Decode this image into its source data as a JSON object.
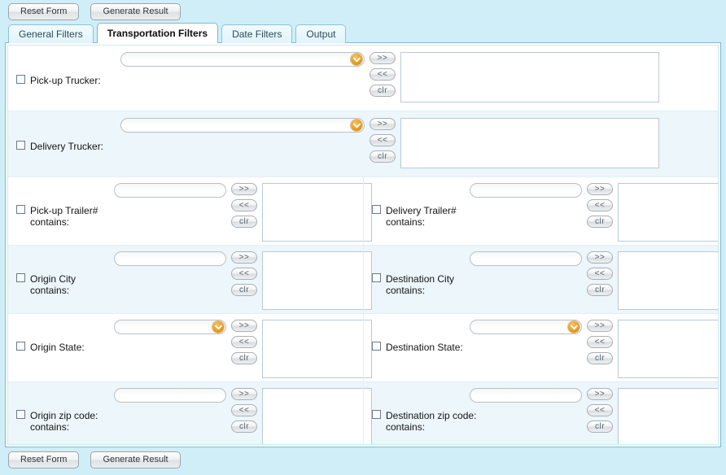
{
  "toolbar": {
    "reset_label": "Reset Form",
    "generate_label": "Generate Result"
  },
  "tabs": [
    {
      "label": "General Filters",
      "active": false
    },
    {
      "label": "Transportation Filters",
      "active": true
    },
    {
      "label": "Date Filters",
      "active": false
    },
    {
      "label": "Output",
      "active": false
    }
  ],
  "buttons": {
    "add_label": ">>",
    "remove_label": "<<",
    "clear_label": "clr"
  },
  "icons": {
    "combo_arrow": "chevron-down-icon"
  },
  "colors": {
    "window_background": "#cfeef8",
    "panel_background": "#ffffff",
    "row_shade": "#ecf6fb",
    "panel_border": "#7fb9d0",
    "tab_border": "#8cc3d8",
    "combo_arrow": "#e89b23",
    "listbox_border": "#b7cbd6",
    "input_border": "#b9c1c6"
  },
  "filters": [
    {
      "id": "pickup-trucker",
      "label": "Pick-up Trucker:",
      "control": "combo",
      "checked": false,
      "value": "",
      "layout": "full",
      "shaded": false,
      "selected_items": []
    },
    {
      "id": "delivery-trucker",
      "label": "Delivery Trucker:",
      "control": "combo",
      "checked": false,
      "value": "",
      "layout": "full",
      "shaded": true,
      "selected_items": []
    },
    {
      "id": "pickup-trailer",
      "label": "Pick-up Trailer#\ncontains:",
      "control": "text",
      "checked": false,
      "value": "",
      "layout": "half",
      "shaded": false,
      "selected_items": []
    },
    {
      "id": "delivery-trailer",
      "label": "Delivery Trailer#\ncontains:",
      "control": "text",
      "checked": false,
      "value": "",
      "layout": "half",
      "shaded": false,
      "selected_items": []
    },
    {
      "id": "origin-city",
      "label": "Origin City\ncontains:",
      "control": "text",
      "checked": false,
      "value": "",
      "layout": "half",
      "shaded": true,
      "selected_items": []
    },
    {
      "id": "destination-city",
      "label": "Destination City\ncontains:",
      "control": "text",
      "checked": false,
      "value": "",
      "layout": "half",
      "shaded": true,
      "selected_items": []
    },
    {
      "id": "origin-state",
      "label": "Origin State:",
      "control": "combo",
      "checked": false,
      "value": "",
      "layout": "half",
      "shaded": false,
      "selected_items": []
    },
    {
      "id": "destination-state",
      "label": "Destination State:",
      "control": "combo",
      "checked": false,
      "value": "",
      "layout": "half",
      "shaded": false,
      "selected_items": []
    },
    {
      "id": "origin-zip",
      "label": "Origin zip code:\ncontains:",
      "control": "text",
      "checked": false,
      "value": "",
      "layout": "half",
      "shaded": true,
      "selected_items": []
    },
    {
      "id": "destination-zip",
      "label": "Destination zip code:\ncontains:",
      "control": "text",
      "checked": false,
      "value": "",
      "layout": "half",
      "shaded": true,
      "selected_items": []
    }
  ],
  "footer": {
    "reset_label": "Reset Form",
    "generate_label": "Generate Result"
  }
}
